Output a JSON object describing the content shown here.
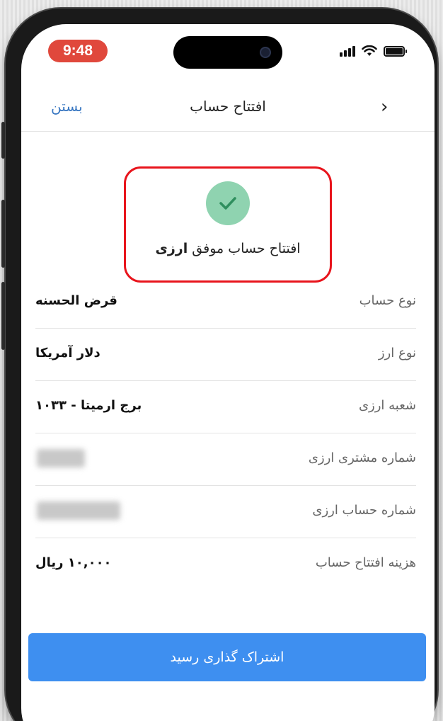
{
  "status_bar": {
    "time": "9:48",
    "icons": [
      "signal-icon",
      "wifi-icon",
      "battery-icon"
    ]
  },
  "header": {
    "back_icon": "chevron-right-icon",
    "back_glyph": "›",
    "title": "افتتاح حساب",
    "close_label": "بستن"
  },
  "success": {
    "icon": "check-icon",
    "message_prefix": "افتتاح حساب موفق",
    "message_bold": "ارزی"
  },
  "details": [
    {
      "label": "نوع حساب",
      "value": "قرض الحسنه"
    },
    {
      "label": "نوع ارز",
      "value": "دلار آمریکا"
    },
    {
      "label": "شعبه ارزی",
      "value": "برج ارمیتا - ۱۰۳۳"
    },
    {
      "label": "شماره مشتری ارزی",
      "value": ""
    },
    {
      "label": "شماره حساب ارزی",
      "value": ""
    },
    {
      "label": "هزینه افتتاح حساب",
      "value": "۱۰,۰۰۰ ریال"
    }
  ],
  "share_button": {
    "label": "اشتراک گذاری رسید"
  },
  "colors": {
    "accent": "#3e8ff0",
    "close_link": "#3a78c2",
    "success_circle": "#8fd3b0",
    "highlight_border": "#e8141c",
    "time_pill": "#e0483c"
  }
}
